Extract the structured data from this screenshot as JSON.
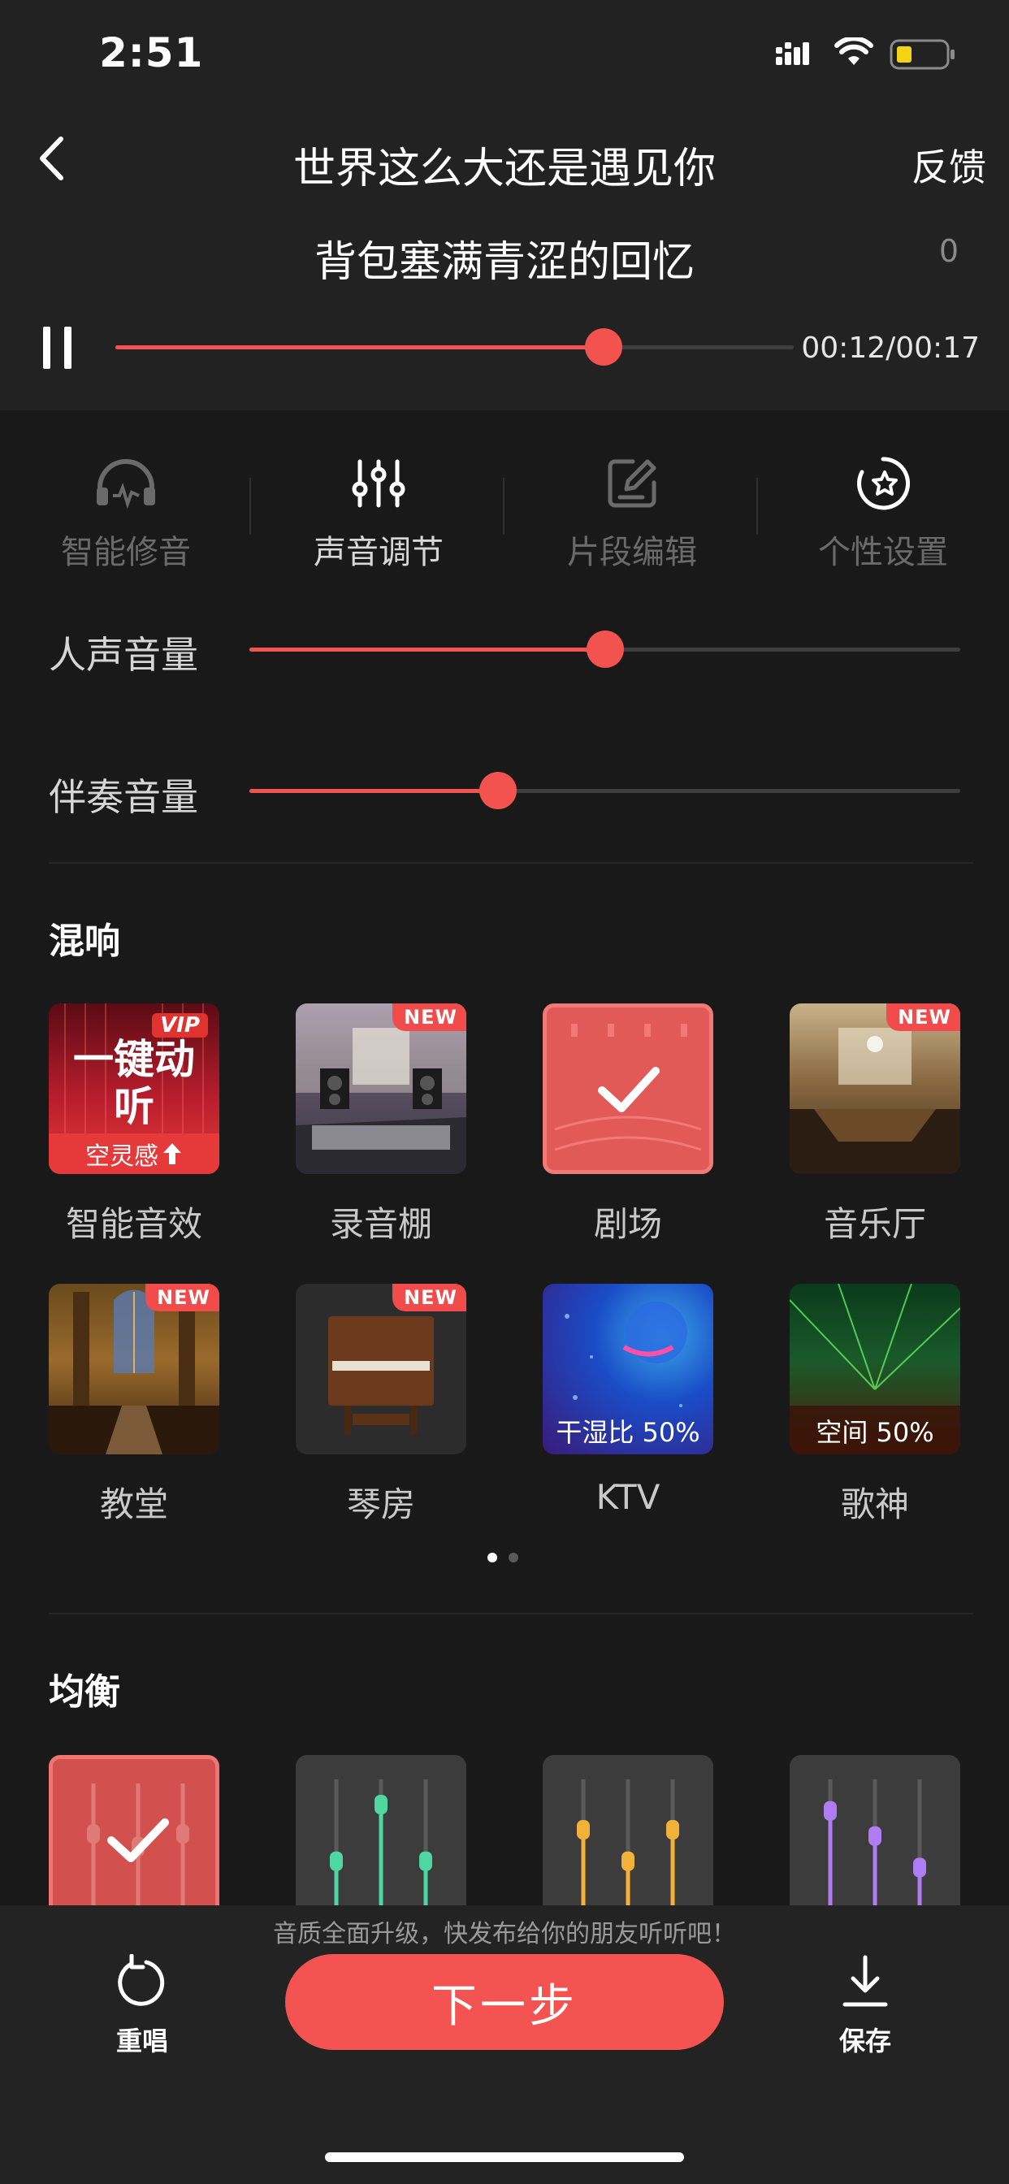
{
  "status_bar": {
    "time": "2:51",
    "icons": [
      "signal-icon",
      "wifi-icon",
      "battery-icon"
    ]
  },
  "header": {
    "title": "世界这么大还是遇见你",
    "feedback_label": "反馈",
    "back_icon": "back-icon"
  },
  "player": {
    "lyric": "背包塞满青涩的回忆",
    "score": "0",
    "time": "00:12/00:17",
    "progress": 0.72,
    "pause_icon": "pause-icon"
  },
  "tabs": [
    {
      "label": "智能修音",
      "icon": "headphone-icon",
      "active": false
    },
    {
      "label": "声音调节",
      "icon": "equalizer-sliders-icon",
      "active": true
    },
    {
      "label": "片段编辑",
      "icon": "edit-icon",
      "active": false
    },
    {
      "label": "个性设置",
      "icon": "star-badge-icon",
      "active": false
    }
  ],
  "volumes": [
    {
      "label": "人声音量",
      "value": 0.5
    },
    {
      "label": "伴奏音量",
      "value": 0.35
    }
  ],
  "reverb": {
    "title": "混响",
    "items": [
      {
        "label": "智能音效",
        "badge": "VIP",
        "art_text": "一键动听",
        "overlay": "空灵感",
        "selected": false
      },
      {
        "label": "录音棚",
        "badge": "NEW",
        "overlay": "",
        "selected": false
      },
      {
        "label": "剧场",
        "badge": "",
        "overlay": "",
        "selected": true
      },
      {
        "label": "音乐厅",
        "badge": "NEW",
        "overlay": "",
        "selected": false
      },
      {
        "label": "教堂",
        "badge": "NEW",
        "overlay": "",
        "selected": false
      },
      {
        "label": "琴房",
        "badge": "NEW",
        "overlay": "",
        "selected": false
      },
      {
        "label": "KTV",
        "badge": "",
        "overlay": "干湿比 50%",
        "selected": false
      },
      {
        "label": "歌神",
        "badge": "",
        "overlay": "空间 50%",
        "selected": false
      }
    ],
    "page_count": 2,
    "current_page": 0
  },
  "equalizer": {
    "title": "均衡",
    "presets": [
      {
        "color": "#f15a57",
        "selected": true,
        "levels": [
          0.6,
          0.5,
          0.6
        ]
      },
      {
        "color": "#4ed6a3",
        "selected": false,
        "levels": [
          0.35,
          0.8,
          0.35
        ]
      },
      {
        "color": "#f2b23a",
        "selected": false,
        "levels": [
          0.6,
          0.35,
          0.6
        ]
      },
      {
        "color": "#b07cf2",
        "selected": false,
        "levels": [
          0.75,
          0.55,
          0.3
        ]
      }
    ]
  },
  "bottom_bar": {
    "hint": "音质全面升级，快发布给你的朋友听听吧！",
    "retry_label": "重唱",
    "next_label": "下一步",
    "save_label": "保存"
  },
  "colors": {
    "accent": "#f2534f",
    "background": "#191919",
    "panel": "#222222"
  }
}
